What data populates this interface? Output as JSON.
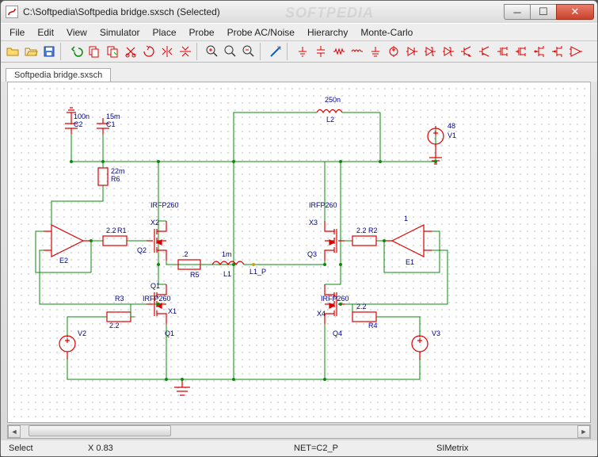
{
  "title": "C:\\Softpedia\\Softpedia bridge.sxsch (Selected)",
  "watermark": "SOFTPEDIA",
  "menu": [
    "File",
    "Edit",
    "View",
    "Simulator",
    "Place",
    "Probe",
    "Probe AC/Noise",
    "Hierarchy",
    "Monte-Carlo"
  ],
  "tab": "Softpedia bridge.sxsch",
  "status": {
    "mode": "Select",
    "coord": "X  0.83",
    "net": "NET=C2_P",
    "app": "SIMetrix"
  },
  "labels": {
    "c2v": "100n",
    "c2": "C2",
    "c1v": "15m",
    "c1": "C1",
    "r6v": "22m",
    "r6": "R6",
    "x2": "IRFP260",
    "r1v": "2.2",
    "r1": "R1",
    "q2": "Q2",
    "x2b": "X2",
    "e2": "E2",
    "r5v": ".2",
    "r5": "R5",
    "l1v": "1m",
    "l1": "L1",
    "q1": "Q1",
    "x3": "IRFP260",
    "r2v": "2.2",
    "r2": "R2",
    "q3": "Q3",
    "x3b": "X3",
    "one": "1",
    "e1": "E1",
    "l2v": "250n",
    "l2": "L2",
    "v1v": "48",
    "v1": "V1",
    "x1": "IRFP260",
    "r3": "R3",
    "r3v": "2.2",
    "q4l": "Q1",
    "v2": "V2",
    "x1b": "X1",
    "x4": "IRFP260",
    "r4v": "2.2",
    "r4": "R4",
    "q4": "Q4",
    "x4b": "X4",
    "v3": "V3"
  }
}
